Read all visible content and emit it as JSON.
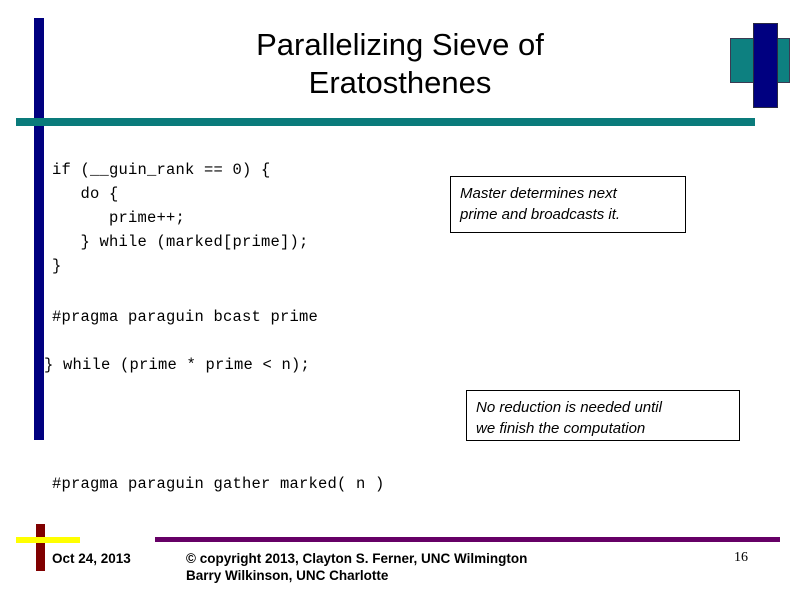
{
  "slide": {
    "title": "Parallelizing Sieve of\nEratosthenes",
    "colors": {
      "navy": "#000080",
      "teal": "#0a7b7b",
      "purple": "#660066",
      "dark_red": "#800000",
      "yellow": "#ffff00",
      "text": "#000000"
    }
  },
  "code_blocks": [
    {
      "id": "code-block-1",
      "text": "if (__guin_rank == 0) {\n   do {\n      prime++;\n   } while (marked[prime]);\n}"
    },
    {
      "id": "code-block-2",
      "text": "#pragma paraguin bcast prime"
    },
    {
      "id": "code-block-3",
      "text": "} while (prime * prime < n);"
    },
    {
      "id": "code-block-4",
      "text": "#pragma paraguin gather marked( n )"
    }
  ],
  "callouts": [
    {
      "id": "callout-1",
      "text": "Master determines next\nprime and broadcasts it."
    },
    {
      "id": "callout-2",
      "text": "No reduction is needed until\nwe finish the computation"
    }
  ],
  "footer": {
    "date": "Oct 24, 2013",
    "copyright": "© copyright 2013, Clayton S. Ferner, UNC Wilmington\nBarry Wilkinson, UNC Charlotte",
    "page_number": "16"
  }
}
